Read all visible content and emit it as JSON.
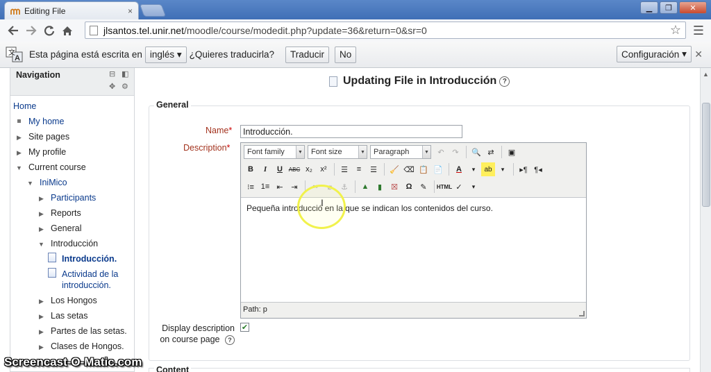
{
  "browser": {
    "tab_title": "Editing File",
    "url_host": "jlsantos.tel.unir.net",
    "url_path": "/moodle/course/modedit.php?update=36&return=0&sr=0",
    "close_tab": "×"
  },
  "translate_bar": {
    "message": "Esta página está escrita en",
    "language": "inglés",
    "question": "¿Quieres traducirla?",
    "translate_button": "Traducir",
    "no_button": "No",
    "settings_button": "Configuración"
  },
  "navigation": {
    "title": "Navigation",
    "home": "Home",
    "my_home": "My home",
    "site_pages": "Site pages",
    "my_profile": "My profile",
    "current_course": "Current course",
    "course": "IniMico",
    "participants": "Participants",
    "reports": "Reports",
    "general": "General",
    "introduccion_section": "Introducción",
    "introduccion_item": "Introducción.",
    "actividad_line1": "Actividad de la",
    "actividad_line2": "introducción.",
    "los_hongos": "Los Hongos",
    "las_setas": "Las setas",
    "partes_setas": "Partes de las setas.",
    "clases_hongos": "Clases de Hongos."
  },
  "form": {
    "page_title": "Updating File in Introducción",
    "section_general": "General",
    "section_content": "Content",
    "name_label": "Name",
    "name_value": "Introducción.",
    "description_label": "Description",
    "required_mark": "*",
    "font_family": "Font family",
    "font_size": "Font size",
    "paragraph": "Paragraph",
    "description_text": "Pequeña introducció en la que se indican los contenidos del curso.",
    "path_label": "Path: p",
    "display_desc_line1": "Display description",
    "display_desc_line2": "on course page",
    "display_desc_checked": true
  },
  "watermark": "Screencast-O-Matic.com",
  "icons": [
    "moodle-favicon",
    "back-icon",
    "forward-icon",
    "reload-icon",
    "home-icon",
    "page-icon",
    "star-icon",
    "wrench-icon",
    "translate-icon",
    "close-icon",
    "help-icon",
    "document-icon",
    "collapse-icon",
    "dock-icon",
    "gear-icon"
  ],
  "colors": {
    "link": "#0a3a8c",
    "label": "#a3331e",
    "chrome_blue": "#4a7bc0"
  }
}
